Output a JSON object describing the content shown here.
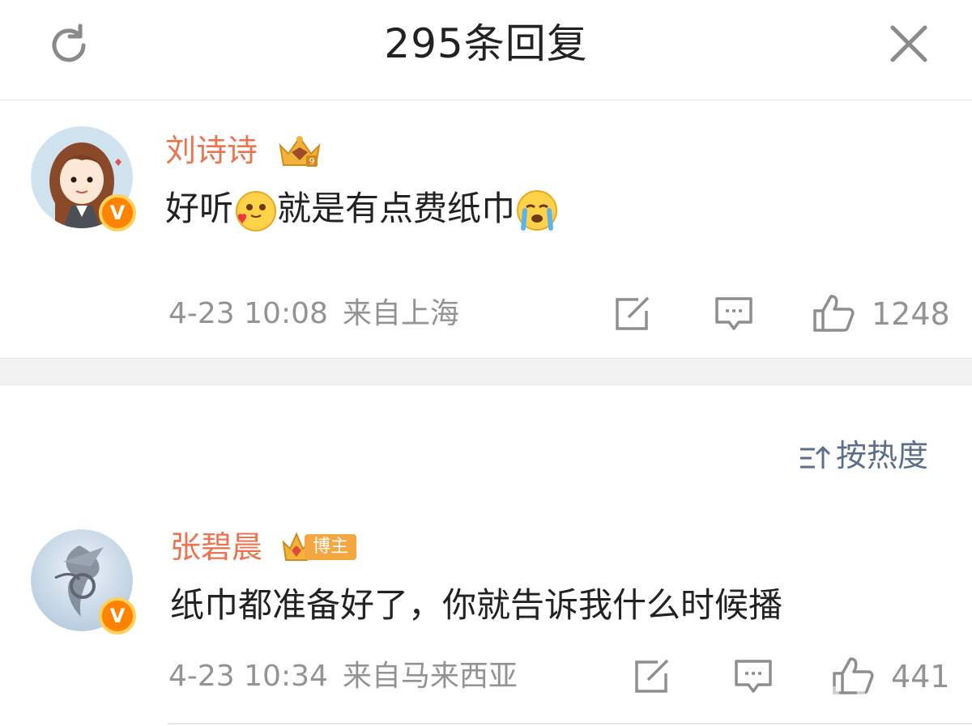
{
  "header": {
    "title": "295条回复",
    "refresh_icon": "refresh-icon",
    "close_icon": "close-icon"
  },
  "main_comment": {
    "username": "刘诗诗",
    "text_parts": [
      "好听",
      "就是有点费纸巾"
    ],
    "emojis": [
      "heart-eyes-emoji",
      "crying-emoji"
    ],
    "time": "4-23 10:08",
    "location": "来自上海",
    "likes": "1248",
    "verified": "V"
  },
  "sort": {
    "label": "按热度"
  },
  "reply": {
    "username": "张碧晨",
    "badge": "博主",
    "text": "纸巾都准备好了，你就告诉我什么时候播",
    "time": "4-23 10:34",
    "location": "来自马来西亚",
    "likes": "441",
    "verified": "V"
  },
  "colors": {
    "username": "#eb7350",
    "meta": "#939393",
    "sort": "#5c6f8a",
    "verified": "#ff8200"
  }
}
